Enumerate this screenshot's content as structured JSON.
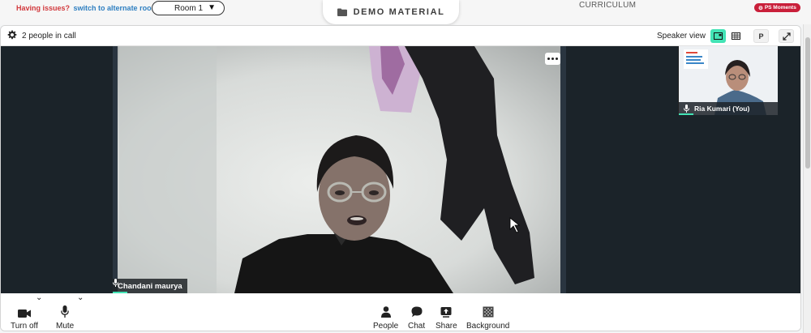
{
  "topbar": {
    "issues_text": "Having issues?",
    "alternate_link": "switch to alternate room",
    "room_value": "Room 1",
    "center_tab": "DEMO MATERIAL",
    "curriculum": "CURRICULUM",
    "moments_badge": "PS Moments"
  },
  "call": {
    "people_count": "2 people in call",
    "speaker_view_label": "Speaker view",
    "participant_main": "Chandani maurya",
    "participant_self": "Ria Kumari (You)",
    "p_button": "P"
  },
  "toolbar": {
    "camera": "Turn off",
    "mute": "Mute",
    "people": "People",
    "chat": "Chat",
    "share": "Share",
    "background": "Background"
  },
  "colors": {
    "accent": "#43e3b5",
    "alert": "#d2393d",
    "link": "#2f7fc1",
    "badge": "#c91f3a",
    "stage": "#1b2329"
  },
  "icons": [
    "gear-icon",
    "folder-icon",
    "caret-down-icon",
    "sidebar-view-icon",
    "grid-view-icon",
    "fullscreen-icon",
    "more-icon",
    "mic-icon",
    "camera-icon",
    "people-icon",
    "chat-icon",
    "share-icon",
    "background-icon"
  ]
}
